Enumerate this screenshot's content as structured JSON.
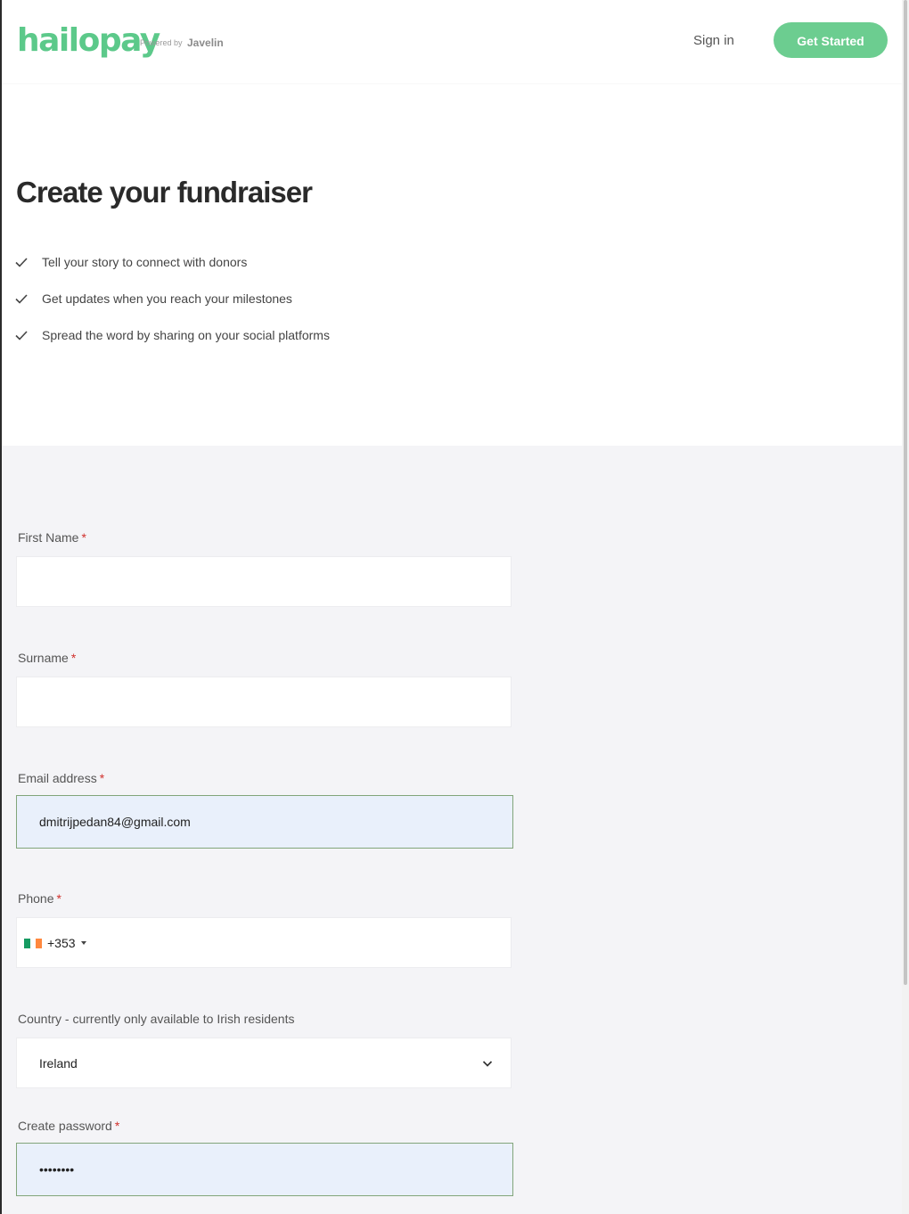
{
  "header": {
    "logo": "hailopay",
    "powered_by": "Powered by",
    "partner": "Javelin",
    "sign_in": "Sign in",
    "get_started": "Get Started"
  },
  "hero": {
    "title": "Create your fundraiser",
    "benefits": [
      "Tell your story to connect with donors",
      "Get updates when you reach your milestones",
      "Spread the word by sharing on your social platforms"
    ]
  },
  "form": {
    "first_name": {
      "label": "First Name",
      "required_mark": "*",
      "value": ""
    },
    "surname": {
      "label": "Surname",
      "required_mark": "*",
      "value": ""
    },
    "email": {
      "label": "Email address",
      "required_mark": "*",
      "value": "dmitrijpedan84@gmail.com"
    },
    "phone": {
      "label": "Phone",
      "required_mark": "*",
      "dial_code": "+353",
      "country_flag": "ireland-flag-icon",
      "value": ""
    },
    "country": {
      "label": "Country - currently only available to Irish residents",
      "value": "Ireland"
    },
    "password": {
      "label": "Create password",
      "required_mark": "*",
      "value": "••••••••"
    }
  },
  "colors": {
    "brand": "#5cc98a",
    "button": "#6ccd90",
    "required": "#d0312d",
    "autofill_bg": "#e9f0fb",
    "autofill_border": "#82a57a",
    "form_bg": "#f4f4f7"
  }
}
